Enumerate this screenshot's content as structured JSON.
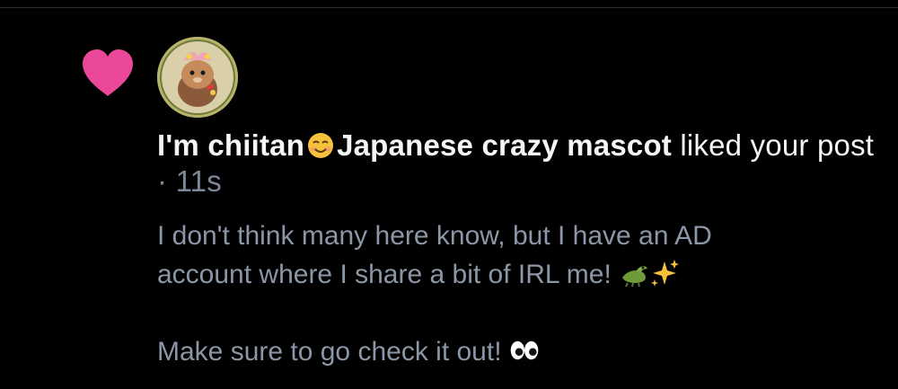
{
  "notification": {
    "user_display_name": "I'm chiitan",
    "user_display_name_suffix": "Japanese crazy mascot",
    "name_emoji": "smiling-face-icon",
    "action_text": " liked your post",
    "separator": " · ",
    "timestamp": "11s",
    "post_line_1": "I don't think many here know, but I have an AD",
    "post_line_2": "account where I share a bit of IRL me!",
    "post_line_3": "Make sure to go check it out!",
    "icons": {
      "like": "heart-icon",
      "emoji_1": "crocodile-icon",
      "emoji_2": "sparkles-icon",
      "emoji_3": "eyes-icon"
    },
    "colors": {
      "heart": "#ec4899",
      "text_primary": "#f3f5f7",
      "text_secondary": "#8b96a6",
      "background": "#000000"
    }
  }
}
